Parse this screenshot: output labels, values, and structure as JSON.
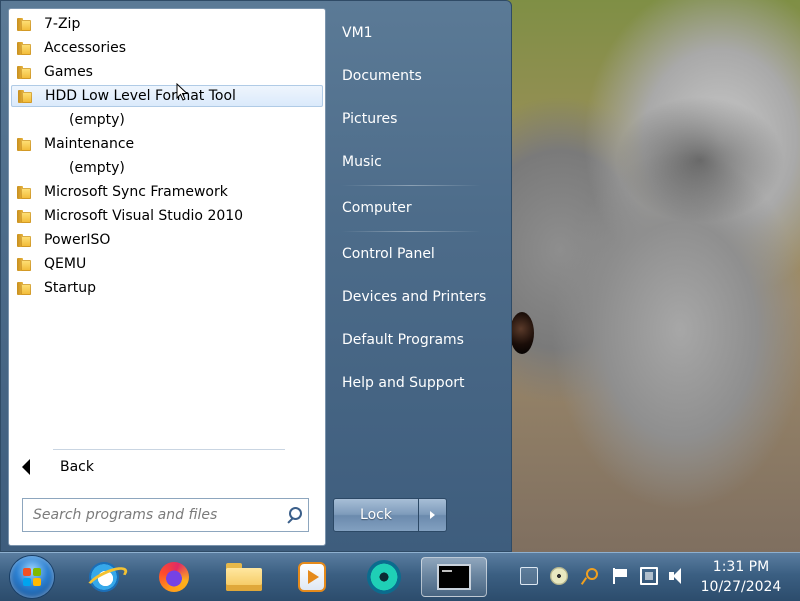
{
  "start_menu": {
    "programs": [
      {
        "label": "7-Zip",
        "type": "folder"
      },
      {
        "label": "Accessories",
        "type": "folder"
      },
      {
        "label": "Games",
        "type": "folder"
      },
      {
        "label": "HDD Low Level Format Tool",
        "type": "folder",
        "selected": true
      },
      {
        "label": "(empty)",
        "type": "empty"
      },
      {
        "label": "Maintenance",
        "type": "folder"
      },
      {
        "label": "(empty)",
        "type": "empty"
      },
      {
        "label": "Microsoft Sync Framework",
        "type": "folder"
      },
      {
        "label": "Microsoft Visual Studio 2010",
        "type": "folder"
      },
      {
        "label": "PowerISO",
        "type": "folder"
      },
      {
        "label": "QEMU",
        "type": "folder"
      },
      {
        "label": "Startup",
        "type": "folder"
      }
    ],
    "back_label": "Back",
    "search": {
      "placeholder": "Search programs and files",
      "value": ""
    },
    "right_items": {
      "user": "VM1",
      "documents": "Documents",
      "pictures": "Pictures",
      "music": "Music",
      "computer": "Computer",
      "control_panel": "Control Panel",
      "devices_printers": "Devices and Printers",
      "default_programs": "Default Programs",
      "help_support": "Help and Support"
    },
    "lock_label": "Lock"
  },
  "taskbar": {
    "pinned_icons": [
      "internet-explorer-icon",
      "firefox-icon",
      "file-explorer-icon",
      "media-player-icon",
      "dvd-maker-icon",
      "command-prompt-icon"
    ],
    "active_icon": "command-prompt-icon",
    "tray_icons": [
      "keyboard-icon",
      "cd-drive-icon",
      "key-icon",
      "action-center-flag-icon",
      "network-icon",
      "volume-icon"
    ],
    "clock": {
      "time": "1:31 PM",
      "date": "10/27/2024"
    }
  },
  "colors": {
    "start_menu_bg": "#4d6c8a",
    "taskbar_bg": "#3b5f82",
    "selected_item_bg": "#dbeafb"
  }
}
